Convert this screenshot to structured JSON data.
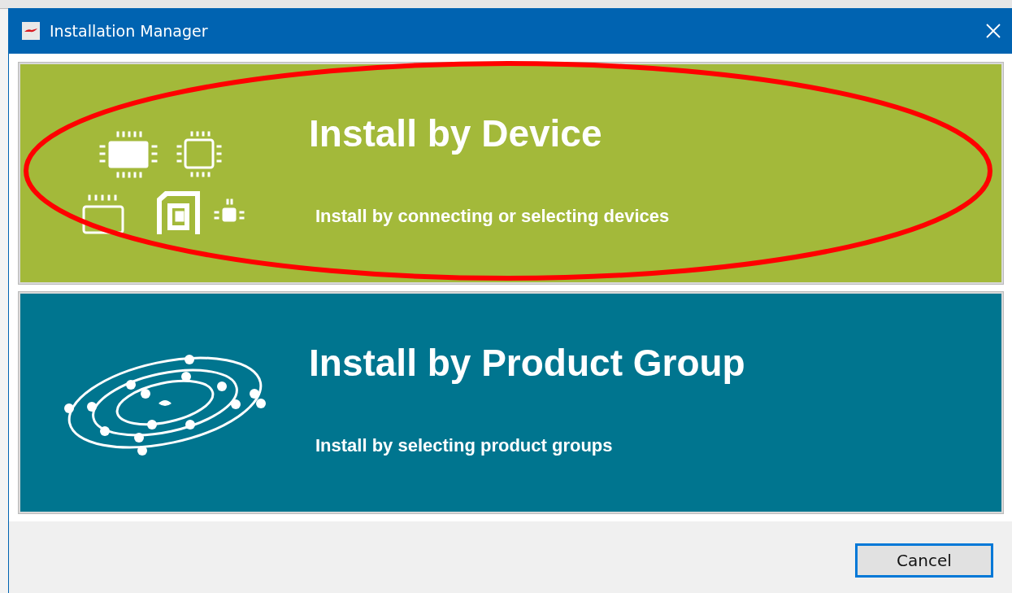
{
  "window": {
    "title": "Installation Manager"
  },
  "options": [
    {
      "kind": "device",
      "title": "Install by Device",
      "subtitle": "Install by connecting or selecting devices",
      "highlighted": true
    },
    {
      "kind": "product_group",
      "title": "Install by Product Group",
      "subtitle": "Install by selecting product groups",
      "highlighted": false
    }
  ],
  "buttons": [
    {
      "label": "Cancel"
    }
  ]
}
